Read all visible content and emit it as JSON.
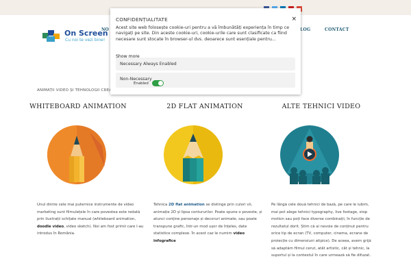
{
  "logo": {
    "name": "On Screen",
    "tagline": "Cu noi te vezi bine!"
  },
  "nav": {
    "left_fragment": "NO",
    "items": [
      "LOG",
      "CONTACT"
    ]
  },
  "social_colors": [
    "#3b5998",
    "#55acee",
    "#0077b5",
    "#cd201f",
    "#dd4b39"
  ],
  "breadcrumb": "ANIMAȚII VIDEO ȘI TEHNOLOGII CREATIVE",
  "columns": [
    {
      "title": "WHITEBOARD ANIMATION",
      "icon": "pencil-icon",
      "colors": {
        "bg": "#e57a26",
        "accent": "#f3b32c"
      },
      "desc": {
        "p1": "Unul dintre cele mai puternice instrumente de video marketing sunt filmulețele în care povestea este redată prin ilustrații schițate manual (whiteboard animation, ",
        "bold": "doodle video",
        "p2": ", video sketch). Noi am fost primii care l-au introdus în România."
      }
    },
    {
      "title": "2D FLAT ANIMATION",
      "icon": "pencil-icon",
      "colors": {
        "bg": "#f2c81f",
        "accent": "#1e8f8a"
      },
      "desc": {
        "p1": "Tehnica ",
        "bold": "2D flat animation",
        "p2": " se distinge prin culori vii, animație 2D și lipsa contururilor. Poate spune o poveste, și atunci conține personaje și decoruri animate, sau poate transpune grafic, într-un mod ușor de înțeles, date statistice complexe. În acest caz le numim ",
        "bold2": "video infografice"
      }
    },
    {
      "title": "ALTE TEHNICI VIDEO",
      "icon": "play-icon",
      "colors": {
        "bg": "#1f7f8f",
        "accent": "#f26a2e"
      },
      "desc": {
        "p1": "Pe lângă cele două tehnici de bază, pe care le iubim, mai pot alege tehnici typography, live footage, stop motion sau poți face diverse combinații, în funcție de rezultatul dorit. Știm că ai nevoie de conținut pentru orice tip de ecran (TV, computer, cinema, ecrane de proiecție cu dimensiuni atipice). De aceea, avem grijă să adaptăm filmul cerut, atât artistic, cât și tehnic, la suportul și la contextul în care urmează să fie difuzat."
      }
    }
  ],
  "cookie": {
    "title": "CONFIDENȚIALITATE",
    "close": "×",
    "text": "Acest site web folosește cookie-uri pentru a vă îmbunătăți experiența în timp ce navigați pe site. Din aceste cookie-uri, cookie-urile care sunt clasificate ca fiind necesare sunt stocate în browser-ul dvs. deoarece sunt esențiale pentru...",
    "show_more": "Show more",
    "necessary": {
      "label": "Necessary",
      "status": "Always Enabled"
    },
    "non_necessary": {
      "label": "Non-Necessary",
      "status": "Enabled",
      "enabled": true,
      "toggle_color": "#2f9e44"
    }
  }
}
